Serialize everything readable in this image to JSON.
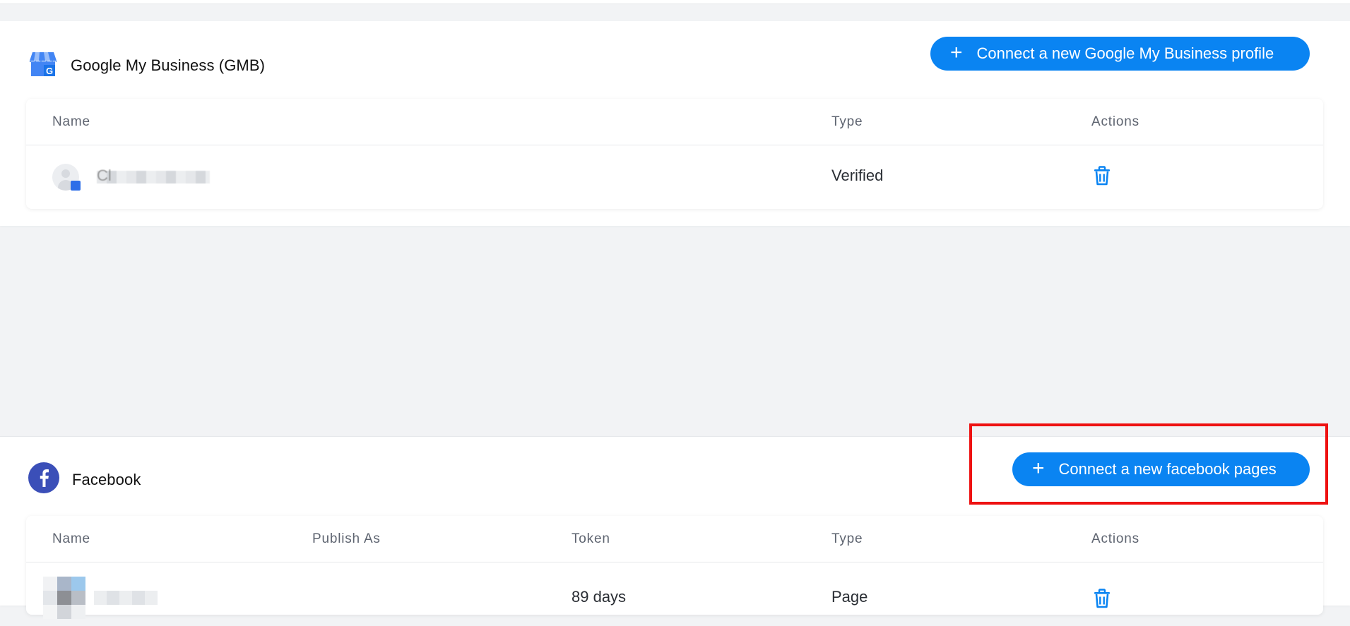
{
  "gmb": {
    "title": "Google My Business (GMB)",
    "connect_label": "Connect a new Google My Business profile",
    "columns": [
      "Name",
      "Type",
      "Actions"
    ],
    "rows": [
      {
        "name": "Cl",
        "type": "Verified"
      }
    ]
  },
  "facebook": {
    "title": "Facebook",
    "connect_label": "Connect a new facebook pages",
    "columns": [
      "Name",
      "Publish As",
      "Token",
      "Type",
      "Actions"
    ],
    "rows": [
      {
        "token": "89 days",
        "type": "Page"
      }
    ]
  },
  "colors": {
    "accent": "#0a84f2",
    "highlight": "#ee1111",
    "background": "#f2f3f5"
  },
  "icons": {
    "plus": "plus-icon",
    "trash": "trash-icon",
    "gmb": "google-my-business-icon",
    "facebook": "facebook-icon"
  }
}
